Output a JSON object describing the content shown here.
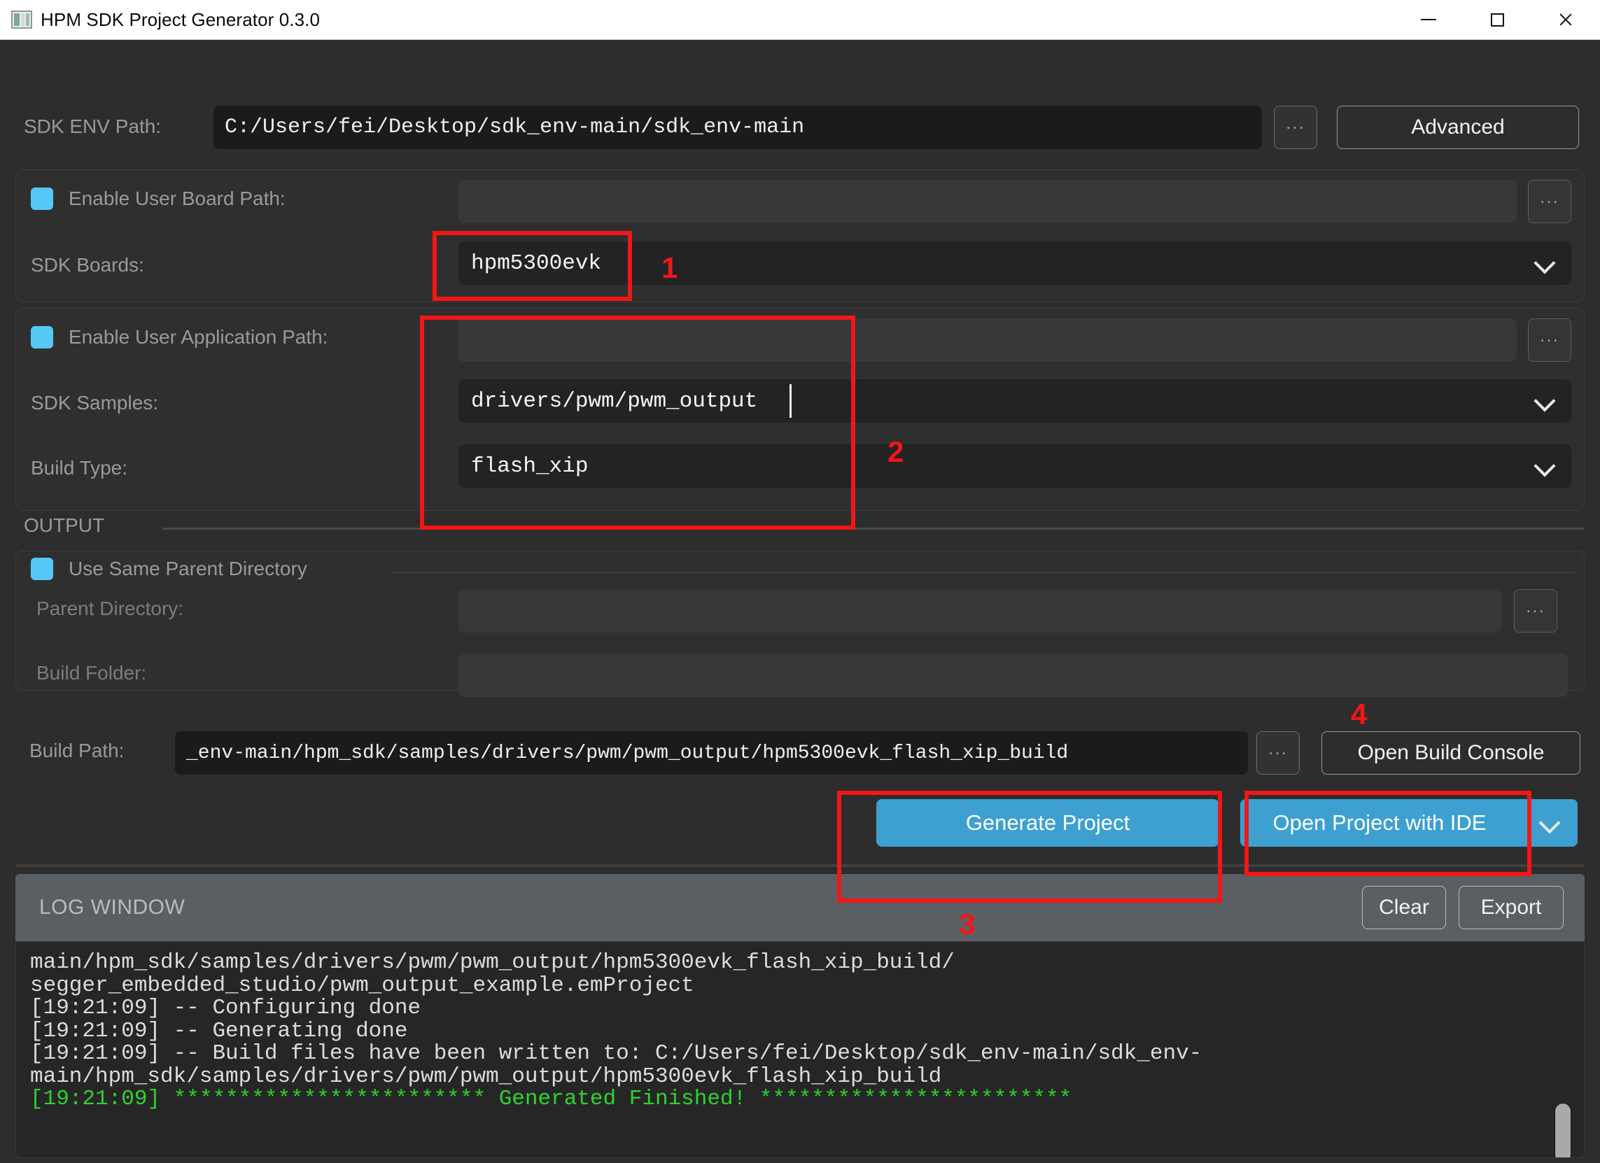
{
  "window": {
    "title": "HPM SDK Project Generator 0.3.0",
    "icon": "app-icon",
    "minimize": "—",
    "maximize": "□",
    "close": "✕"
  },
  "sdk_env": {
    "label": "SDK ENV Path:",
    "value": "C:/Users/fei/Desktop/sdk_env-main/sdk_env-main",
    "browse": "...",
    "advanced": "Advanced"
  },
  "board_group": {
    "enable_user_board_label": "Enable User Board Path:",
    "user_board_path": "",
    "user_board_browse": "...",
    "sdk_boards_label": "SDK Boards:",
    "sdk_boards_value": "hpm5300evk"
  },
  "app_group": {
    "enable_user_app_label": "Enable User Application Path:",
    "user_app_path": "",
    "user_app_browse": "...",
    "sdk_samples_label": "SDK Samples:",
    "sdk_samples_value": "drivers/pwm/pwm_output",
    "build_type_label": "Build Type:",
    "build_type_value": "flash_xip"
  },
  "output": {
    "section_label": "OUTPUT",
    "use_same_parent_label": "Use Same Parent Directory",
    "parent_dir_label": "Parent Directory:",
    "parent_dir_value": "",
    "parent_dir_browse": "...",
    "build_folder_label": "Build Folder:",
    "build_folder_value": "",
    "build_path_label": "Build Path:",
    "build_path_value": "_env-main/hpm_sdk/samples/drivers/pwm/pwm_output/hpm5300evk_flash_xip_build",
    "build_path_browse": "...",
    "open_build_console": "Open Build Console"
  },
  "actions": {
    "generate_project": "Generate Project",
    "open_project_with_ide": "Open Project with IDE",
    "ide_dropdown_icon": "chevron-down-icon"
  },
  "log": {
    "title": "LOG WINDOW",
    "clear": "Clear",
    "export": "Export",
    "lines": [
      {
        "text": "main/hpm_sdk/samples/drivers/pwm/pwm_output/hpm5300evk_flash_xip_build/",
        "ok": false
      },
      {
        "text": "segger_embedded_studio/pwm_output_example.emProject",
        "ok": false
      },
      {
        "text": "[19:21:09] -- Configuring done",
        "ok": false
      },
      {
        "text": "[19:21:09] -- Generating done",
        "ok": false
      },
      {
        "text": "[19:21:09] -- Build files have been written to: C:/Users/fei/Desktop/sdk_env-main/sdk_env-",
        "ok": false
      },
      {
        "text": "main/hpm_sdk/samples/drivers/pwm/pwm_output/hpm5300evk_flash_xip_build",
        "ok": false
      },
      {
        "text": "[19:21:09] ************************ Generated Finished! ************************",
        "ok": true
      }
    ]
  },
  "annotations": [
    {
      "number": "1"
    },
    {
      "number": "2"
    },
    {
      "number": "3"
    },
    {
      "number": "4"
    }
  ],
  "colors": {
    "accent_blue": "#3da0d0",
    "checkbox_blue": "#56c8f5",
    "annotation_red": "#f31616",
    "log_success_green": "#2fd22f",
    "window_bg": "#2d2d2d"
  }
}
